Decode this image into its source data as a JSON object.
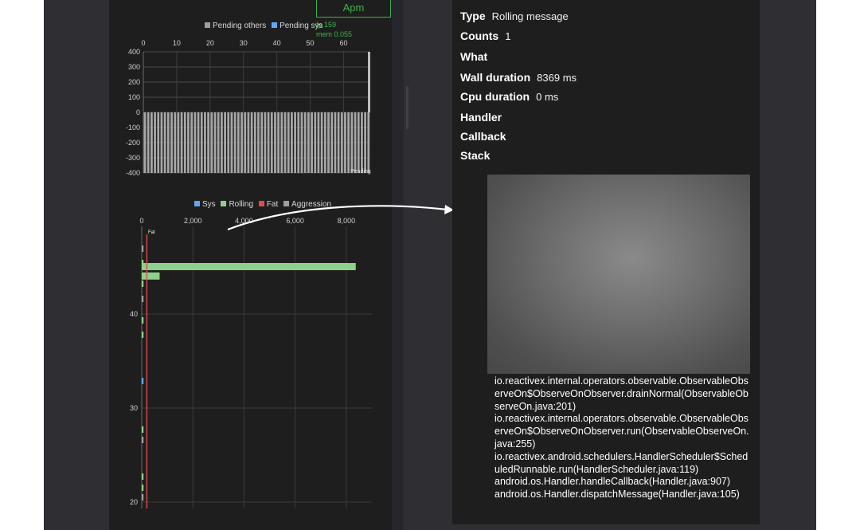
{
  "apm": {
    "button_label": "Apm",
    "fps": "fp 159",
    "mem": "mem 0.055"
  },
  "pending_chart": {
    "legend": [
      {
        "label": "Pending others",
        "color": "#9e9e9e"
      },
      {
        "label": "Pending sys",
        "color": "#5fa8f0"
      }
    ],
    "x_ticks": [
      "0",
      "10",
      "20",
      "30",
      "40",
      "50",
      "60"
    ],
    "y_ticks": [
      "400",
      "300",
      "200",
      "100",
      "0",
      "-100",
      "-200",
      "-300",
      "-400"
    ],
    "annotation": "Pending"
  },
  "rolling_chart": {
    "legend": [
      {
        "label": "Sys",
        "color": "#5fa8f0"
      },
      {
        "label": "Rolling",
        "color": "#8dd18a"
      },
      {
        "label": "Fat",
        "color": "#e04a4a"
      },
      {
        "label": "Aggression",
        "color": "#9e9e9e"
      }
    ],
    "x_ticks": [
      "0",
      "2,000",
      "4,000",
      "6,000",
      "8,000"
    ],
    "y_ticks": [
      "40",
      "30",
      "20"
    ],
    "bar_label": "Fat"
  },
  "chart_data": [
    {
      "type": "bar",
      "title": "",
      "legend": [
        "Pending others",
        "Pending sys"
      ],
      "xlim": [
        0,
        68
      ],
      "ylim": [
        -400,
        400
      ],
      "series": [
        {
          "name": "Pending others",
          "value_at_each_x_0_to_68": -400,
          "last_value": 400
        }
      ]
    },
    {
      "type": "bar",
      "orientation": "horizontal",
      "title": "",
      "legend": [
        "Sys",
        "Rolling",
        "Fat",
        "Aggression"
      ],
      "xlim": [
        0,
        9000
      ],
      "series": [
        {
          "name": "Rolling",
          "bars": [
            {
              "index": 45,
              "value": 8369
            },
            {
              "index": 44,
              "value": 700
            }
          ]
        }
      ],
      "reference_line": {
        "name": "Fat",
        "x": 200
      }
    }
  ],
  "details": {
    "rows": [
      {
        "key": "Type",
        "value": "Rolling message"
      },
      {
        "key": "Counts",
        "value": "1"
      },
      {
        "key": "What",
        "value": ""
      },
      {
        "key": "Wall duration",
        "value": "8369 ms"
      },
      {
        "key": "Cpu duration",
        "value": "0 ms"
      },
      {
        "key": "Handler",
        "value": ""
      },
      {
        "key": "Callback",
        "value": ""
      },
      {
        "key": "Stack",
        "value": ""
      }
    ],
    "stack_trace": "io.reactivex.internal.operators.observable.ObservableObserveOn$ObserveOnObserver.drainNormal(ObservableObserveOn.java:201)\nio.reactivex.internal.operators.observable.ObservableObserveOn$ObserveOnObserver.run(ObservableObserveOn.java:255)\nio.reactivex.android.schedulers.HandlerScheduler$ScheduledRunnable.run(HandlerScheduler.java:119)\nandroid.os.Handler.handleCallback(Handler.java:907)\nandroid.os.Handler.dispatchMessage(Handler.java:105)"
  }
}
